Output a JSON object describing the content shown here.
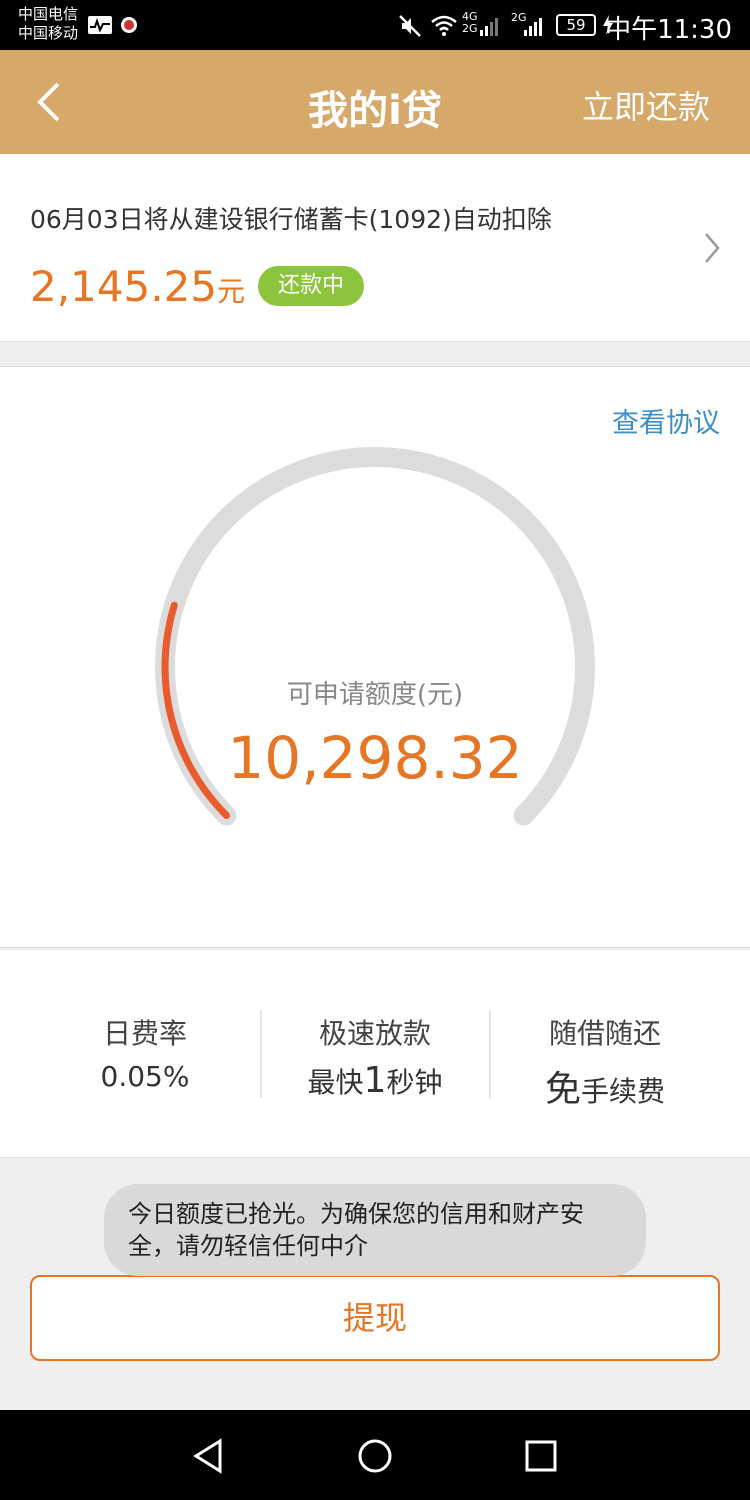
{
  "status_bar": {
    "carrier_1": "中国电信",
    "carrier_2": "中国移动",
    "network_1": "4G",
    "network_2": "2G",
    "network_3": "2G",
    "battery": "59",
    "time": "中午11:30"
  },
  "header": {
    "title": "我的i贷",
    "action": "立即还款"
  },
  "repayment": {
    "description": "06月03日将从建设银行储蓄卡(1092)自动扣除",
    "amount": "2,145.25",
    "unit": "元",
    "status": "还款中"
  },
  "credit": {
    "view_agreement": "查看协议",
    "label": "可申请额度(元)",
    "amount": "10,298.32",
    "gauge_fraction": 0.23,
    "colors": {
      "track": "#dcdcdc",
      "progress": "#e95a2d",
      "amount": "#e67524"
    }
  },
  "features": [
    {
      "title": "日费率",
      "value": "0.05%"
    },
    {
      "title": "极速放款",
      "prefix": "最快",
      "big": "1",
      "suffix": "秒钟"
    },
    {
      "title": "随借随还",
      "big": "免",
      "suffix": "手续费"
    }
  ],
  "toast": "今日额度已抢光。为确保您的信用和财产安全，请勿轻信任何中介",
  "withdraw_label": "提现",
  "colors": {
    "header": "#d6a96a",
    "accent": "#e67524",
    "badge": "#8cc43c",
    "link": "#3b8ec6"
  }
}
